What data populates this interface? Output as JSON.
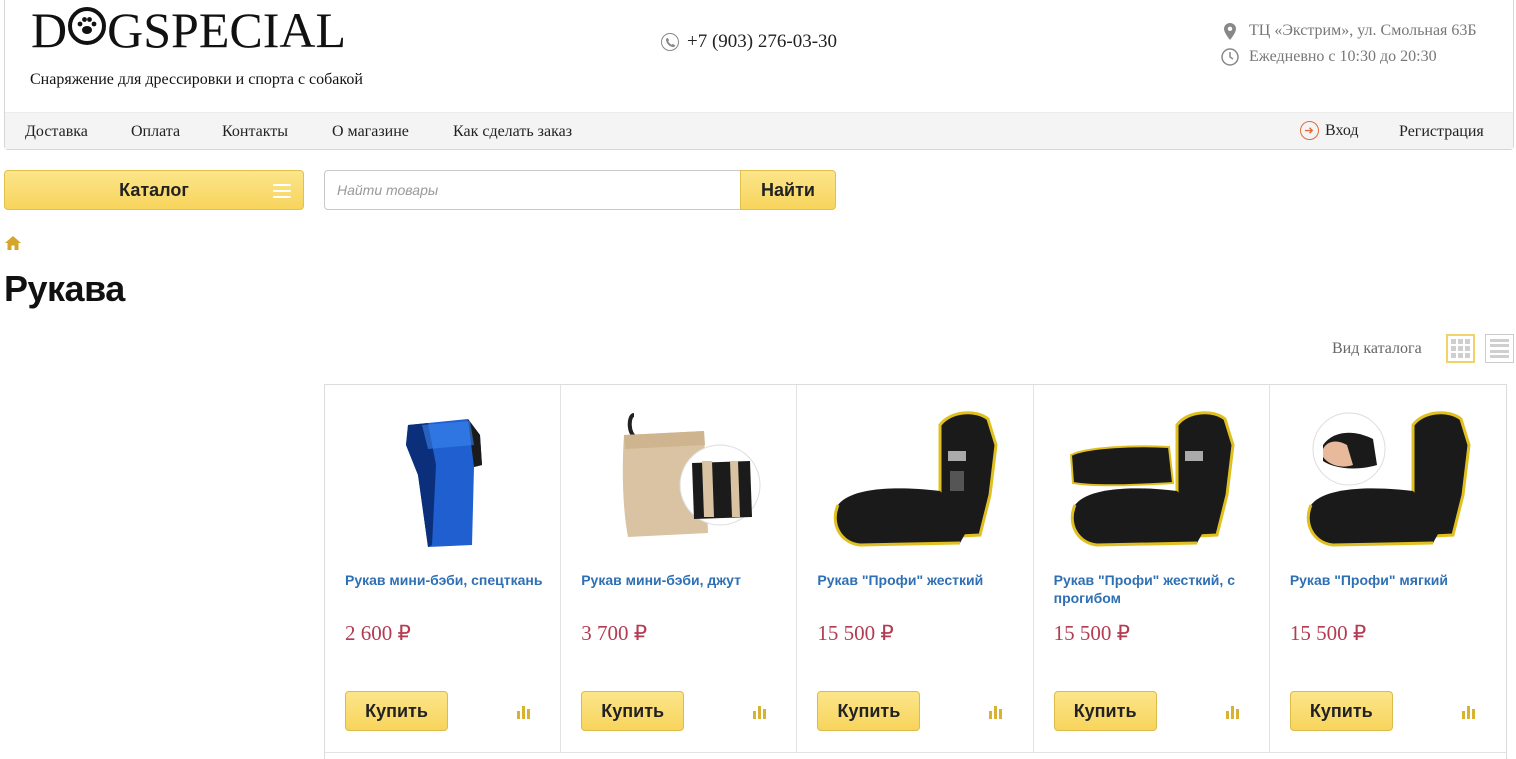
{
  "header": {
    "logo_text_left": "D",
    "logo_text_right": "GSPECIAL",
    "tagline": "Снаряжение для дрессировки и спорта с собакой",
    "phone": "+7 (903) 276-03-30",
    "address": "ТЦ «Экстрим», ул. Смольная 63Б",
    "hours": "Ежедневно с 10:30 до 20:30"
  },
  "nav": {
    "items": [
      "Доставка",
      "Оплата",
      "Контакты",
      "О магазине",
      "Как сделать заказ"
    ],
    "login": "Вход",
    "register": "Регистрация"
  },
  "toolbar": {
    "catalog_label": "Каталог",
    "search_placeholder": "Найти товары",
    "search_button": "Найти"
  },
  "page": {
    "title": "Рукава",
    "view_label": "Вид каталога"
  },
  "products": [
    {
      "name": "Рукав мини-бэби, спецткань",
      "price": "2 600 ₽",
      "buy": "Купить"
    },
    {
      "name": "Рукав мини-бэби, джут",
      "price": "3 700 ₽",
      "buy": "Купить"
    },
    {
      "name": "Рукав \"Профи\" жесткий",
      "price": "15 500 ₽",
      "buy": "Купить"
    },
    {
      "name": "Рукав \"Профи\" жесткий, с прогибом",
      "price": "15 500 ₽",
      "buy": "Купить"
    },
    {
      "name": "Рукав \"Профи\" мягкий",
      "price": "15 500 ₽",
      "buy": "Купить"
    }
  ],
  "colors": {
    "accent_yellow": "#f7d45c",
    "link_blue": "#2f6fb3",
    "price_red": "#b33b52"
  }
}
